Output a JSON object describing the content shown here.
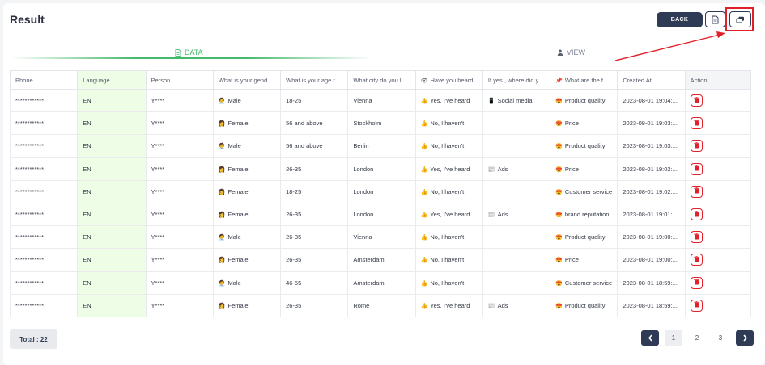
{
  "header": {
    "title": "Result",
    "back_label": "BACK"
  },
  "tabs": [
    {
      "label": "DATA",
      "icon": "document-icon",
      "active": true
    },
    {
      "label": "VIEW",
      "icon": "person-icon",
      "active": false
    }
  ],
  "table": {
    "columns": [
      "Phone",
      "Language",
      "Person",
      "What is your gend...",
      "What is your age r...",
      "What city do you li...",
      "Have you heard...",
      "If yes , where did y...",
      "What are the f...",
      "Created At",
      "Action"
    ],
    "column_icons": {
      "Have you heard...": "eye-icon",
      "What are the f...": "pin-icon"
    },
    "rows": [
      {
        "phone": "************",
        "language": "EN",
        "person": "Y****",
        "gender": "Male",
        "gender_icon": "man-icon",
        "age": "18-25",
        "city": "Vienna",
        "heard": "Yes, I've heard",
        "heard_icon": "thumb-icon",
        "where": "Social media",
        "where_icon": "phone-icon",
        "feature": "Product quality",
        "feature_icon": "heart-eyes-icon",
        "created": "2023-08-01 19:04:..."
      },
      {
        "phone": "************",
        "language": "EN",
        "person": "Y****",
        "gender": "Female",
        "gender_icon": "woman-icon",
        "age": "56 and above",
        "city": "Stockholm",
        "heard": "No, I haven't",
        "heard_icon": "thumb-icon",
        "where": "",
        "where_icon": "",
        "feature": "Price",
        "feature_icon": "heart-eyes-icon",
        "created": "2023-08-01 19:03:..."
      },
      {
        "phone": "************",
        "language": "EN",
        "person": "Y****",
        "gender": "Male",
        "gender_icon": "man-icon",
        "age": "56 and above",
        "city": "Berlin",
        "heard": "No, I haven't",
        "heard_icon": "thumb-icon",
        "where": "",
        "where_icon": "",
        "feature": "Product quality",
        "feature_icon": "heart-eyes-icon",
        "created": "2023-08-01 19:03:..."
      },
      {
        "phone": "************",
        "language": "EN",
        "person": "Y****",
        "gender": "Female",
        "gender_icon": "woman-icon",
        "age": "26-35",
        "city": "London",
        "heard": "Yes, I've heard",
        "heard_icon": "thumb-icon",
        "where": "Ads",
        "where_icon": "billboard-icon",
        "feature": "Price",
        "feature_icon": "heart-eyes-icon",
        "created": "2023-08-01 19:02:..."
      },
      {
        "phone": "************",
        "language": "EN",
        "person": "Y****",
        "gender": "Female",
        "gender_icon": "woman-icon",
        "age": "18-25",
        "city": "London",
        "heard": "No, I haven't",
        "heard_icon": "thumb-icon",
        "where": "",
        "where_icon": "",
        "feature": "Customer service",
        "feature_icon": "heart-eyes-icon",
        "created": "2023-08-01 19:02:..."
      },
      {
        "phone": "************",
        "language": "EN",
        "person": "Y****",
        "gender": "Female",
        "gender_icon": "woman-icon",
        "age": "26-35",
        "city": "London",
        "heard": "Yes, I've heard",
        "heard_icon": "thumb-icon",
        "where": "Ads",
        "where_icon": "billboard-icon",
        "feature": "brand reputation",
        "feature_icon": "heart-eyes-icon",
        "created": "2023-08-01 19:01:..."
      },
      {
        "phone": "************",
        "language": "EN",
        "person": "Y****",
        "gender": "Male",
        "gender_icon": "man-icon",
        "age": "26-35",
        "city": "Vienna",
        "heard": "No, I haven't",
        "heard_icon": "thumb-icon",
        "where": "",
        "where_icon": "",
        "feature": "Product quality",
        "feature_icon": "heart-eyes-icon",
        "created": "2023-08-01 19:00:..."
      },
      {
        "phone": "************",
        "language": "EN",
        "person": "Y****",
        "gender": "Female",
        "gender_icon": "woman-icon",
        "age": "26-35",
        "city": "Amsterdam",
        "heard": "No, I haven't",
        "heard_icon": "thumb-icon",
        "where": "",
        "where_icon": "",
        "feature": "Price",
        "feature_icon": "heart-eyes-icon",
        "created": "2023-08-01 19:00:..."
      },
      {
        "phone": "************",
        "language": "EN",
        "person": "Y****",
        "gender": "Male",
        "gender_icon": "man-icon",
        "age": "46-55",
        "city": "Amsterdam",
        "heard": "No, I haven't",
        "heard_icon": "thumb-icon",
        "where": "",
        "where_icon": "",
        "feature": "Customer service",
        "feature_icon": "heart-eyes-icon",
        "created": "2023-08-01 18:59:..."
      },
      {
        "phone": "************",
        "language": "EN",
        "person": "Y****",
        "gender": "Female",
        "gender_icon": "woman-icon",
        "age": "26-35",
        "city": "Rome",
        "heard": "Yes, I've heard",
        "heard_icon": "thumb-icon",
        "where": "Ads",
        "where_icon": "billboard-icon",
        "feature": "Product quality",
        "feature_icon": "heart-eyes-icon",
        "created": "2023-08-01 18:59:..."
      }
    ]
  },
  "footer": {
    "total_label": "Total : 22",
    "pages": [
      "1",
      "2",
      "3"
    ],
    "current_page": "1"
  },
  "colors": {
    "accent_navy": "#2f3b55",
    "accent_green": "#43b96b",
    "language_column_bg": "#eefde6",
    "delete_red": "#e2202a",
    "annotation_red": "#e2202a"
  }
}
